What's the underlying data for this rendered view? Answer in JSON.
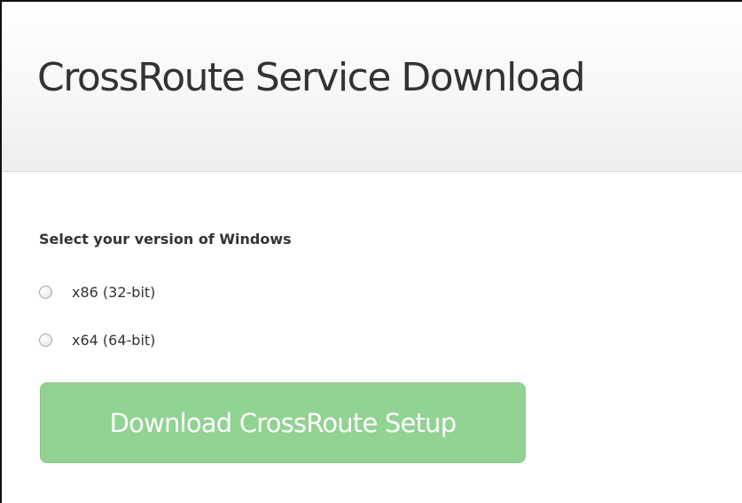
{
  "header": {
    "title": "CrossRoute Service Download"
  },
  "form": {
    "heading": "Select your version of Windows",
    "options": [
      {
        "label": "x86 (32-bit)",
        "selected": false
      },
      {
        "label": "x64 (64-bit)",
        "selected": false
      }
    ],
    "download_button_label": "Download CrossRoute Setup",
    "button_color": "#92d293",
    "button_state": "disabled"
  }
}
